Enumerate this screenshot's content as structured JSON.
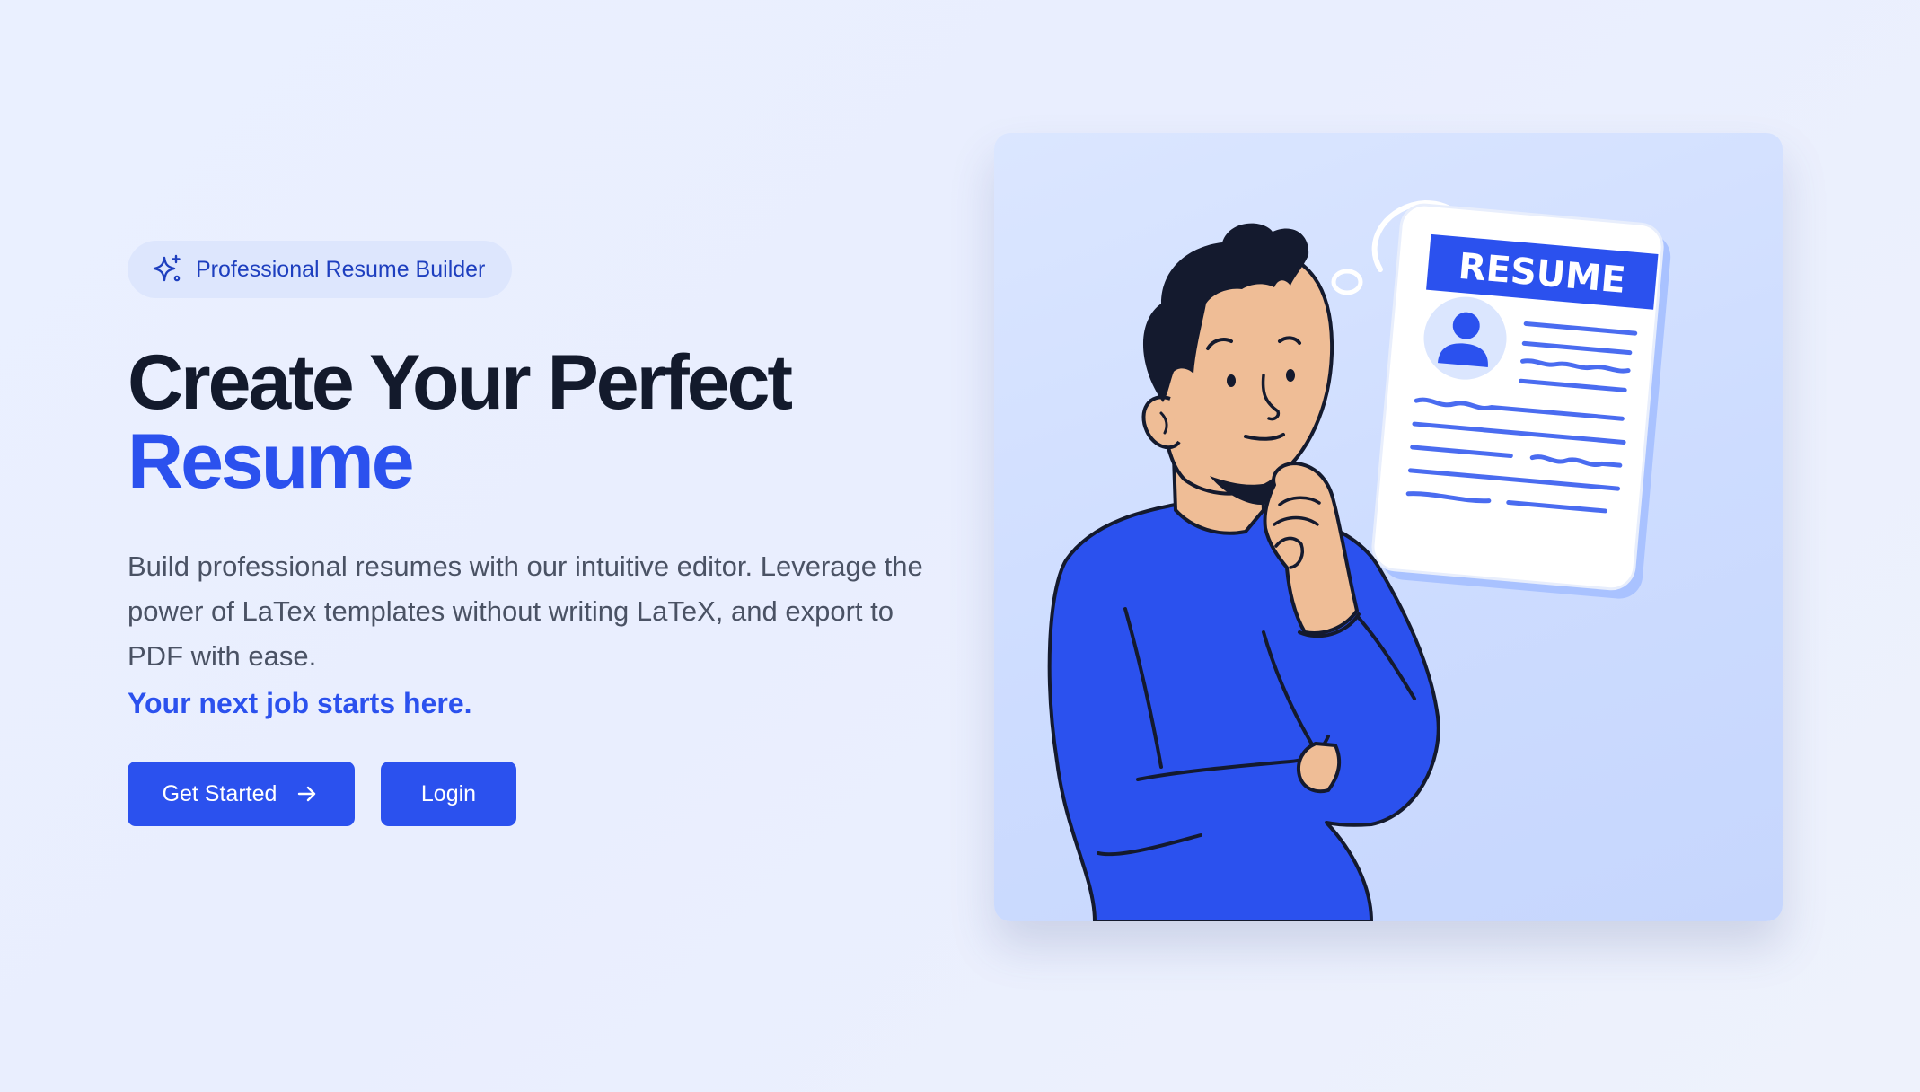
{
  "badge": {
    "icon": "sparkles-icon",
    "label": "Professional Resume Builder"
  },
  "headline": {
    "line1": "Create Your Perfect",
    "line2": "Resume"
  },
  "description": "Build professional resumes with our intuitive editor. Leverage the power of LaTex templates without writing LaTeX, and export to PDF with ease.",
  "tagline": "Your next job starts here.",
  "actions": {
    "get_started_label": "Get Started",
    "get_started_icon": "arrow-right-icon",
    "login_label": "Login"
  },
  "illustration": {
    "document_title": "RESUME"
  },
  "colors": {
    "accent": "#2b51ee",
    "heading": "#131a2c",
    "body_text": "#4a5264",
    "badge_bg": "#dde6fd",
    "illustration_bg": "#cddcff",
    "skin": "#efbd96",
    "hair": "#141a2e"
  }
}
